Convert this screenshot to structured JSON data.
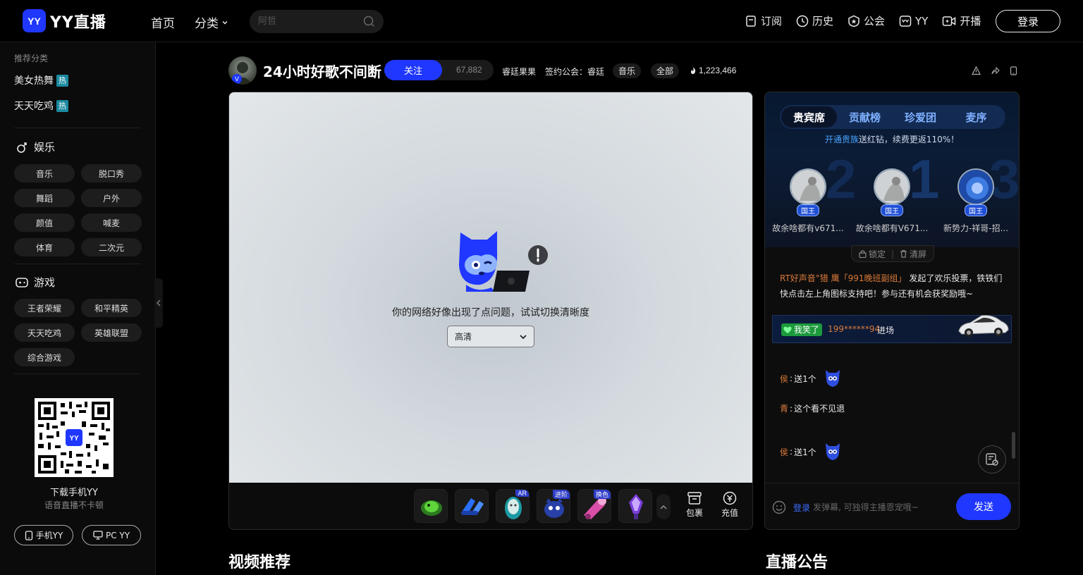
{
  "header": {
    "logo_text": "YY直播",
    "logo_mark": "YY",
    "nav": {
      "home": "首页",
      "category": "分类"
    },
    "search_placeholder": "阿哲",
    "links": [
      {
        "label": "订阅",
        "icon": "subscribe-icon"
      },
      {
        "label": "历史",
        "icon": "history-icon"
      },
      {
        "label": "公会",
        "icon": "guild-icon"
      },
      {
        "label": "YY",
        "icon": "yy-icon"
      },
      {
        "label": "开播",
        "icon": "broadcast-icon"
      }
    ],
    "login": "登录"
  },
  "sidebar": {
    "recommend_title": "推荐分类",
    "recommend": [
      {
        "label": "美女热舞",
        "badge": "热"
      },
      {
        "label": "天天吃鸡",
        "badge": "热"
      }
    ],
    "entertainment": {
      "title": "娱乐",
      "items": [
        "音乐",
        "脱口秀",
        "舞蹈",
        "户外",
        "颜值",
        "喊麦",
        "体育",
        "二次元"
      ]
    },
    "games": {
      "title": "游戏",
      "items": [
        "王者荣耀",
        "和平精英",
        "天天吃鸡",
        "英雄联盟",
        "综合游戏"
      ]
    },
    "download": {
      "qr_label": "YY",
      "title": "下载手机YY",
      "subtitle": "语音直播不卡顿",
      "mobile_btn": "手机YY",
      "pc_btn": "PC YY"
    }
  },
  "room": {
    "title": "24小时好歌不间断",
    "avatar_badge": "V",
    "follow": "关注",
    "follow_count": "67,882",
    "anchor": "睿廷果果",
    "guild": "签约公会：睿廷",
    "tags": [
      "音乐",
      "全部"
    ],
    "heat": "1,223,466"
  },
  "player": {
    "error_message": "你的网络好像出现了点问题，试试切换清晰度",
    "quality": "高清",
    "gift_labels": [
      "AR",
      "进阶",
      "换色"
    ],
    "bag": "包裹",
    "recharge": "充值"
  },
  "panel": {
    "tabs": [
      "贵宾席",
      "贡献榜",
      "珍爱团",
      "麦序"
    ],
    "active_tab": 0,
    "promo_highlight": "开通贵族",
    "promo_text": "送红钻，续费更返110%！",
    "ranks": [
      {
        "name": "故余啥都有v671...",
        "title": "国王"
      },
      {
        "name": "故余啥都有V671...",
        "title": "国王"
      },
      {
        "name": "新势力-祥哥-招...",
        "title": "国王"
      }
    ],
    "rank_numbers": [
      "2",
      "1",
      "3"
    ],
    "lock": "锁定",
    "clear": "清屏",
    "system_msg": {
      "user": "RT好声音°猎",
      "group": "鹰「991晚班副组」",
      "text": "发起了欢乐投票，铁铁们快点击左上角图标支持吧！参与还有机会获奖励哦~"
    },
    "enter": {
      "badge": "我笑了",
      "user": "199******94",
      "action": "进场"
    },
    "messages": [
      {
        "user": "侯",
        "text": "送1个"
      },
      {
        "user": "青",
        "text": "这个看不见退"
      },
      {
        "user": "侯",
        "text": "送1个"
      }
    ],
    "input": {
      "login": "登录",
      "placeholder": "发弹幕, 可独得主播恩宠哦~",
      "send": "发送"
    }
  },
  "sections": {
    "videos": "视频推荐",
    "announcement": "直播公告"
  },
  "colors": {
    "brand": "#1f37ff",
    "accent_orange": "#d9793a",
    "hot": "#1b8aa0"
  }
}
